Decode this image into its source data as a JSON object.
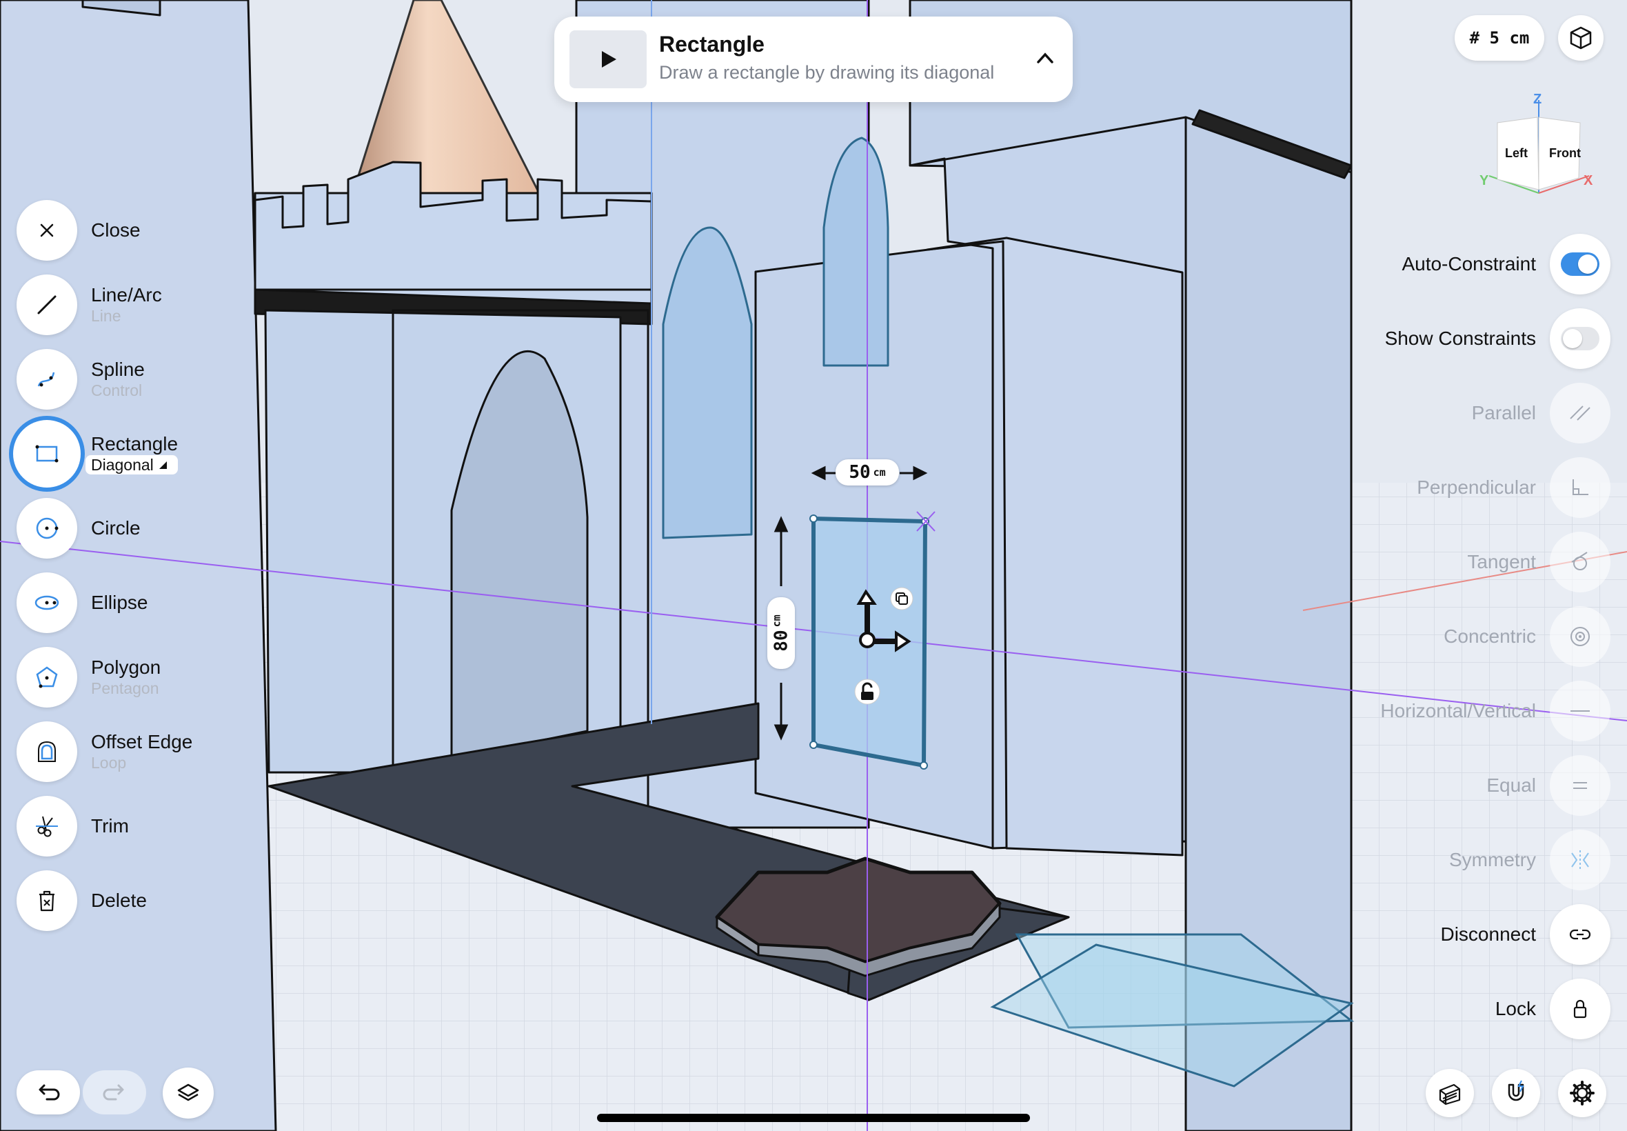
{
  "hint": {
    "title": "Rectangle",
    "description": "Draw a rectangle by drawing its diagonal",
    "play_icon": "play-icon",
    "collapse_icon": "chevron-up-icon"
  },
  "grid_size": "# 5 cm",
  "view_cube": {
    "left": "Left",
    "front": "Front",
    "x": "X",
    "y": "Y",
    "z": "Z"
  },
  "tools": [
    {
      "name": "Close",
      "sub": "",
      "icon": "close-icon"
    },
    {
      "name": "Line/Arc",
      "sub": "Line",
      "icon": "line-icon"
    },
    {
      "name": "Spline",
      "sub": "Control",
      "icon": "spline-icon"
    },
    {
      "name": "Rectangle",
      "sub": "Diagonal",
      "icon": "rectangle-icon",
      "active": true
    },
    {
      "name": "Circle",
      "sub": "",
      "icon": "circle-icon"
    },
    {
      "name": "Ellipse",
      "sub": "",
      "icon": "ellipse-icon"
    },
    {
      "name": "Polygon",
      "sub": "Pentagon",
      "icon": "polygon-icon"
    },
    {
      "name": "Offset Edge",
      "sub": "Loop",
      "icon": "offset-edge-icon"
    },
    {
      "name": "Trim",
      "sub": "",
      "icon": "scissors-icon"
    },
    {
      "name": "Delete",
      "sub": "",
      "icon": "trash-icon"
    }
  ],
  "settings": {
    "auto_constraint": {
      "label": "Auto-Constraint",
      "on": true
    },
    "show_constraints": {
      "label": "Show Constraints",
      "on": false
    }
  },
  "constraints": [
    {
      "label": "Parallel",
      "icon": "parallel-icon",
      "enabled": false
    },
    {
      "label": "Perpendicular",
      "icon": "perpendicular-icon",
      "enabled": false
    },
    {
      "label": "Tangent",
      "icon": "tangent-icon",
      "enabled": false
    },
    {
      "label": "Concentric",
      "icon": "concentric-icon",
      "enabled": false
    },
    {
      "label": "Horizontal/Vertical",
      "icon": "horizontal-vertical-icon",
      "enabled": false
    },
    {
      "label": "Equal",
      "icon": "equal-icon",
      "enabled": false
    },
    {
      "label": "Symmetry",
      "icon": "symmetry-icon",
      "enabled": false
    },
    {
      "label": "Disconnect",
      "icon": "disconnect-icon",
      "enabled": true
    },
    {
      "label": "Lock",
      "icon": "lock-icon",
      "enabled": true
    }
  ],
  "dimensions": {
    "width_value": "50",
    "width_unit": "cm",
    "height_value": "80",
    "height_unit": "cm"
  },
  "bottom": {
    "undo": "undo-icon",
    "redo": "redo-icon",
    "layers": "layers-icon",
    "sections": "section-icon",
    "snap": "magnet-icon",
    "settings": "gear-icon"
  },
  "colors": {
    "accent": "#3a8ee6",
    "sketch_fill": "#a8cdee",
    "sketch_edge": "#2d6a8f",
    "model": "#c6d6ee",
    "ground_path": "#3c4350"
  }
}
